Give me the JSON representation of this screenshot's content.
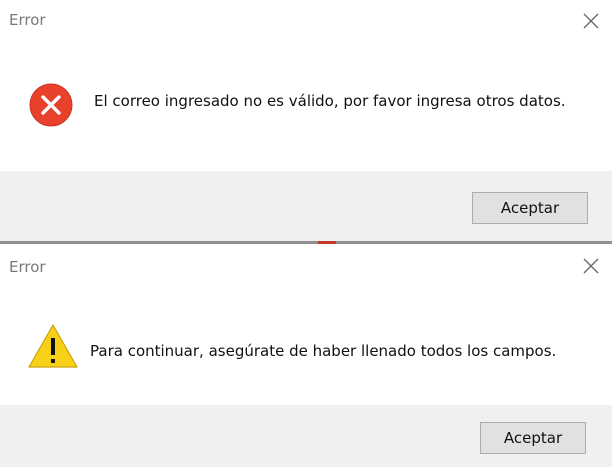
{
  "dialogs": [
    {
      "title": "Error",
      "icon": "error-icon",
      "message": "El correo ingresado no es válido, por favor ingresa otros datos.",
      "button_label": "Aceptar"
    },
    {
      "title": "Error",
      "icon": "warning-icon",
      "message": "Para continuar, asegúrate de haber llenado todos los campos.",
      "button_label": "Aceptar"
    }
  ],
  "colors": {
    "error_red": "#e8412c",
    "warning_yellow": "#f7d117",
    "footer_gray": "#f0f0f0",
    "button_gray": "#e1e1e1"
  }
}
